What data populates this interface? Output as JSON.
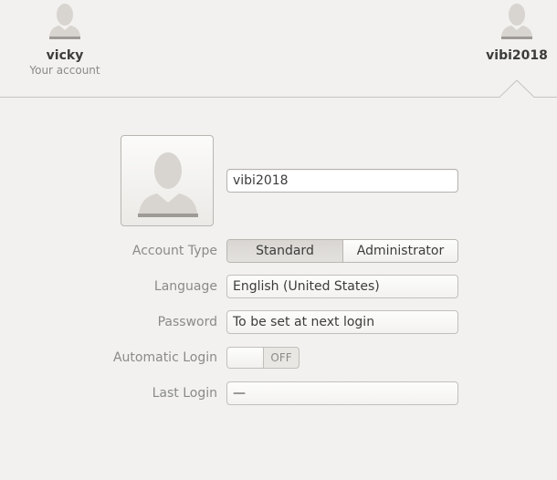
{
  "users": [
    {
      "name": "vicky",
      "subtitle": "Your account",
      "icon": "user-avatar-icon"
    },
    {
      "name": "vibi2018",
      "subtitle": "",
      "icon": "user-avatar-icon"
    }
  ],
  "account": {
    "avatar_icon": "user-avatar-icon",
    "name_value": "vibi2018",
    "account_type": {
      "label": "Account Type",
      "options": [
        "Standard",
        "Administrator"
      ],
      "selected": "Standard"
    },
    "language": {
      "label": "Language",
      "value": "English (United States)"
    },
    "password": {
      "label": "Password",
      "value": "To be set at next login"
    },
    "automatic_login": {
      "label": "Automatic Login",
      "state": "OFF"
    },
    "last_login": {
      "label": "Last Login",
      "value": "—"
    }
  },
  "colors": {
    "background": "#f2f1f0",
    "label": "#8a8a8a",
    "text": "#3c3c3c",
    "selected_segment": "#dcd9d5"
  }
}
